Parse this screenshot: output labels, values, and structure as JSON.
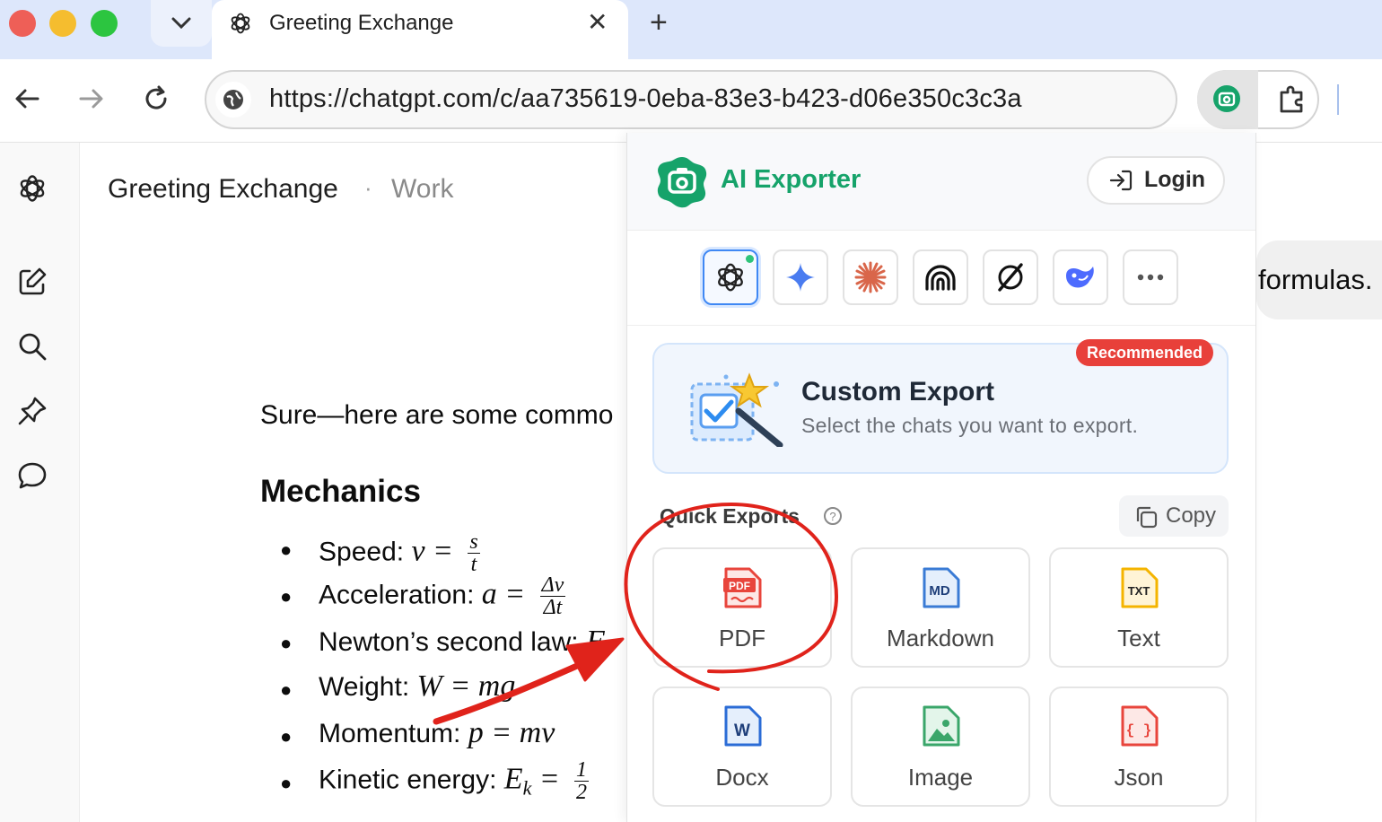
{
  "browser": {
    "tab": {
      "title": "Greeting Exchange"
    },
    "url": "https://chatgpt.com/c/aa735619-0eba-83e3-b423-d06e350c3c3a",
    "new_tab": "+",
    "tab_close": "✕",
    "tab_dropdown": "⌄"
  },
  "chat": {
    "title": "Greeting Exchange",
    "separator": "·",
    "project": "Work",
    "user_message_fragment": "formulas.",
    "reply_intro": "Sure—here are some commo",
    "section_heading": "Mechanics",
    "bullets": [
      {
        "label": "Speed:",
        "math": "v =",
        "num": "s",
        "den": "t"
      },
      {
        "label": "Acceleration:",
        "math": "a =",
        "num": "Δv",
        "den": "Δt"
      },
      {
        "label": "Newton’s second law:",
        "math": "F"
      },
      {
        "label": "Weight:",
        "math": "W = mg"
      },
      {
        "label": "Momentum:",
        "math": "p = mv"
      },
      {
        "label": "Kinetic energy:",
        "math": "E",
        "sub": "k",
        "math2": "=",
        "num": "1",
        "den": "2"
      }
    ]
  },
  "extension": {
    "name": "AI Exporter",
    "login_label": "Login",
    "models": [
      "chatgpt-icon",
      "gemini-icon",
      "claude-icon",
      "perplexity-icon",
      "grok-icon",
      "deepseek-icon",
      "more-icon"
    ],
    "custom_export": {
      "badge": "Recommended",
      "title": "Custom Export",
      "subtitle": "Select the chats you want to export."
    },
    "quick_exports": {
      "label": "Quick Exports",
      "copy_label": "Copy",
      "formats": [
        {
          "label": "PDF",
          "icon_text": "PDF",
          "color": "#e8453c"
        },
        {
          "label": "Markdown",
          "icon_text": "MD",
          "color": "#3a7bd5"
        },
        {
          "label": "Text",
          "icon_text": "TXT",
          "color": "#f4b400"
        },
        {
          "label": "Docx",
          "icon_text": "W",
          "color": "#2b6cd6"
        },
        {
          "label": "Image",
          "icon_text": "",
          "color": "#3aa66a"
        },
        {
          "label": "Json",
          "icon_text": "{ }",
          "color": "#e8453c"
        }
      ]
    }
  },
  "colors": {
    "brand_green": "#16a36a",
    "annotation_red": "#e0231b",
    "selected_blue": "#3f88f4"
  }
}
